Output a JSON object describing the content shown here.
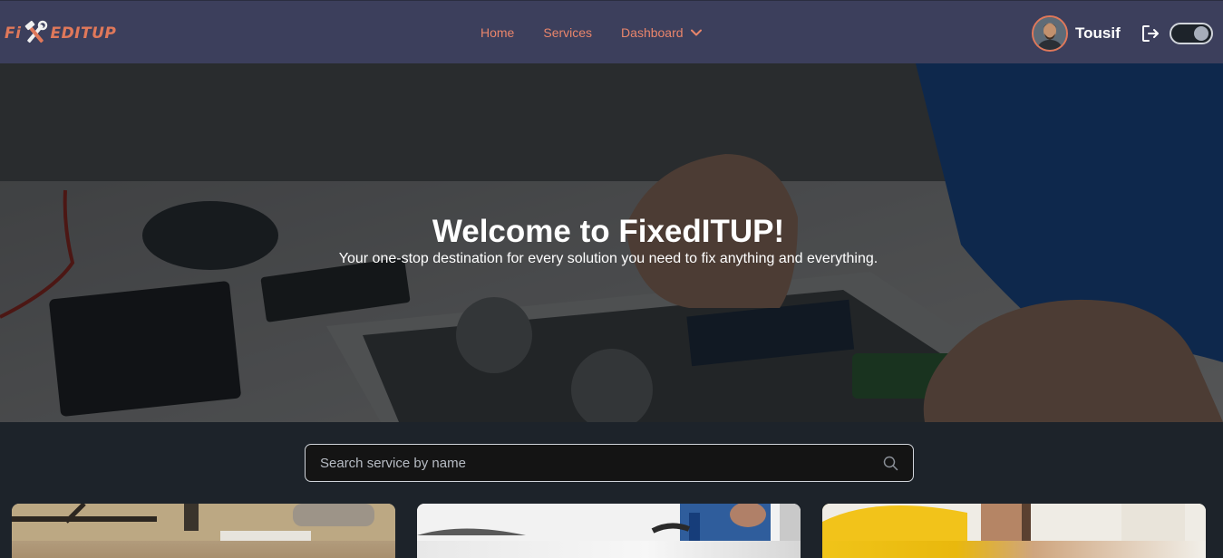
{
  "navbar": {
    "logo": {
      "prefix": "Fi",
      "suffix": "EDITUP",
      "icon": "wrench-hammer-icon"
    },
    "links": {
      "home": "Home",
      "services": "Services",
      "dashboard": "Dashboard"
    },
    "user": {
      "name": "Tousif"
    },
    "logout_icon": "logout-icon",
    "theme_toggle": "on"
  },
  "hero": {
    "title": "Welcome to FixedITUP!",
    "subtitle": "Your one-stop destination for every solution you need to fix anything and everything."
  },
  "search": {
    "placeholder": "Search service by name",
    "icon": "search-icon"
  },
  "colors": {
    "navbar_bg": "#3c3f5c",
    "accent": "#e0785a",
    "page_bg": "#1d232a"
  }
}
